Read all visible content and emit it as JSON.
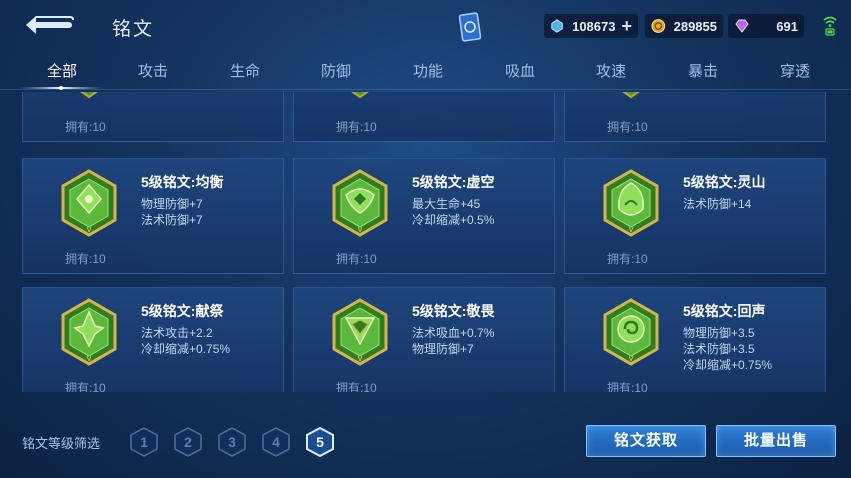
{
  "header": {
    "title": "铭文",
    "back_icon": "back-arrow-icon",
    "card_icon": "rune-card-icon"
  },
  "currencies": {
    "crystal": "108673",
    "gold": "289855",
    "gem": "691"
  },
  "tabs": [
    {
      "label": "全部",
      "active": true
    },
    {
      "label": "攻击"
    },
    {
      "label": "生命"
    },
    {
      "label": "防御"
    },
    {
      "label": "功能"
    },
    {
      "label": "吸血"
    },
    {
      "label": "攻速"
    },
    {
      "label": "暴击"
    },
    {
      "label": "穿透"
    }
  ],
  "top_row": [
    {
      "own": "拥有:10"
    },
    {
      "own": "拥有:10"
    },
    {
      "own": "拥有:10"
    }
  ],
  "runes": [
    {
      "name": "5级铭文:均衡",
      "stats": [
        "物理防御+7",
        "法术防御+7"
      ],
      "own": "拥有:10",
      "icon": "balance-rune-icon"
    },
    {
      "name": "5级铭文:虚空",
      "stats": [
        "最大生命+45",
        "冷却缩减+0.5%"
      ],
      "own": "拥有:10",
      "icon": "void-rune-icon"
    },
    {
      "name": "5级铭文:灵山",
      "stats": [
        "法术防御+14"
      ],
      "own": "拥有:10",
      "icon": "spirit-mountain-rune-icon"
    },
    {
      "name": "5级铭文:献祭",
      "stats": [
        "法术攻击+2.2",
        "冷却缩减+0.75%"
      ],
      "own": "拥有:10",
      "icon": "sacrifice-rune-icon"
    },
    {
      "name": "5级铭文:敬畏",
      "stats": [
        "法术吸血+0.7%",
        "物理防御+7"
      ],
      "own": "拥有:10",
      "icon": "awe-rune-icon"
    },
    {
      "name": "5级铭文:回声",
      "stats": [
        "物理防御+3.5",
        "法术防御+3.5",
        "冷却缩减+0.75%"
      ],
      "own": "拥有:10",
      "icon": "echo-rune-icon"
    }
  ],
  "filter": {
    "label": "铭文等级筛选",
    "levels": [
      "1",
      "2",
      "3",
      "4",
      "5"
    ],
    "active_level": "5"
  },
  "buttons": {
    "obtain": "铭文获取",
    "bulk_sell": "批量出售"
  },
  "colors": {
    "accent": "#2e7fd6",
    "rune_green": "#3f9a2e",
    "rune_gold": "#c9a13a"
  }
}
